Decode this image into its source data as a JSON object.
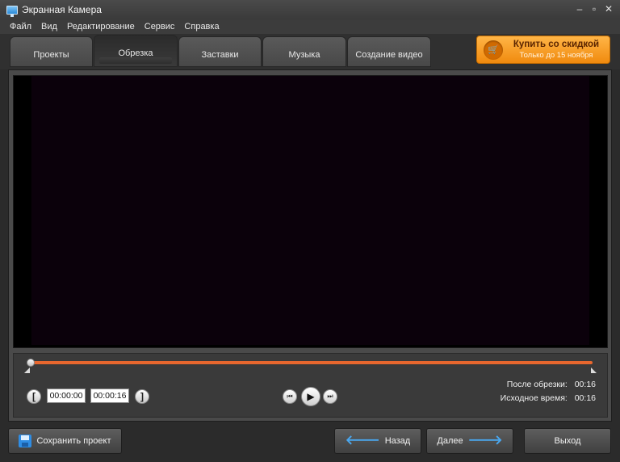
{
  "window": {
    "title": "Экранная Камера",
    "controls": {
      "minimize": "–",
      "maximize": "▫",
      "close": "✕"
    }
  },
  "menu": {
    "items": [
      "Файл",
      "Вид",
      "Редактирование",
      "Сервис",
      "Справка"
    ]
  },
  "tabs": [
    "Проекты",
    "Обрезка",
    "Заставки",
    "Музыка",
    "Создание видео"
  ],
  "active_tab": "Обрезка",
  "promo": {
    "title": "Купить со скидкой",
    "subtitle": "Только до 15 ноября",
    "icon": "cart-icon"
  },
  "player": {
    "start_time": "00:00:00",
    "end_time": "00:00:16",
    "after_trim_label": "После обрезки:",
    "after_trim_value": "00:16",
    "source_time_label": "Исходное время:",
    "source_time_value": "00:16",
    "bracket_left": "[",
    "bracket_right": "]",
    "prev_icon": "⏮",
    "play_icon": "▶",
    "next_icon": "⏭"
  },
  "buttons": {
    "save_project": "Сохранить проект",
    "back": "Назад",
    "next": "Далее",
    "exit": "Выход"
  },
  "colors": {
    "accent": "#e8672e",
    "promo": "#f7a12a",
    "video_bg": "#0b010b"
  }
}
